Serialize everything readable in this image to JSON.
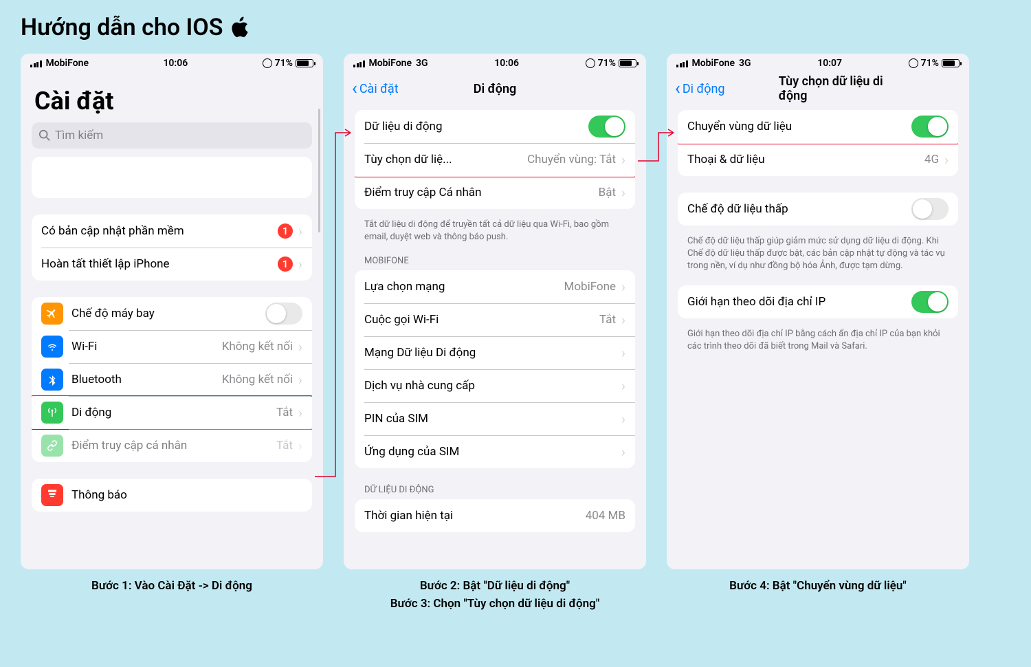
{
  "page": {
    "title": "Hướng dẫn cho IOS"
  },
  "phone1": {
    "status": {
      "carrier": "MobiFone",
      "net": "",
      "time": "10:06",
      "battery": "71%"
    },
    "title": "Cài đặt",
    "search_placeholder": "Tìm kiếm",
    "update_row": {
      "label": "Có bản cập nhật phần mềm",
      "badge": "1"
    },
    "finish_row": {
      "label": "Hoàn tất thiết lập iPhone",
      "badge": "1"
    },
    "rows": {
      "airplane": "Chế độ máy bay",
      "wifi": {
        "label": "Wi-Fi",
        "value": "Không kết nối"
      },
      "bluetooth": {
        "label": "Bluetooth",
        "value": "Không kết nối"
      },
      "mobile": {
        "label": "Di động",
        "value": "Tắt"
      },
      "hotspot": {
        "label": "Điểm truy cập cá nhân",
        "value": "Tắt"
      },
      "notifications": "Thông báo"
    }
  },
  "phone2": {
    "status": {
      "carrier": "MobiFone",
      "net": "3G",
      "time": "10:06",
      "battery": "71%"
    },
    "back": "Cài đặt",
    "title": "Di động",
    "rows": {
      "data": "Dữ liệu di động",
      "options": {
        "label": "Tùy chọn dữ liệ...",
        "value": "Chuyển vùng: Tắt"
      },
      "hotspot": {
        "label": "Điểm truy cập Cá nhân",
        "value": "Bật"
      }
    },
    "footer1": "Tắt dữ liệu di động để truyền tất cả dữ liệu qua Wi-Fi, bao gồm email, duyệt web và thông báo push.",
    "header_mobifone": "MOBIFONE",
    "rows2": {
      "network": {
        "label": "Lựa chọn mạng",
        "value": "MobiFone"
      },
      "wifi_call": {
        "label": "Cuộc gọi Wi-Fi",
        "value": "Tắt"
      },
      "data_net": "Mạng Dữ liệu Di động",
      "carrier_svc": "Dịch vụ nhà cung cấp",
      "sim_pin": "PIN của SIM",
      "sim_apps": "Ứng dụng của SIM"
    },
    "header_data": "DỮ LIỆU DI ĐỘNG",
    "rows3": {
      "current": {
        "label": "Thời gian hiện tại",
        "value": "404 MB"
      }
    }
  },
  "phone3": {
    "status": {
      "carrier": "MobiFone",
      "net": "3G",
      "time": "10:07",
      "battery": "71%"
    },
    "back": "Di động",
    "title": "Tùy chọn dữ liệu di động",
    "rows": {
      "roaming": "Chuyển vùng dữ liệu",
      "voice": {
        "label": "Thoại & dữ liệu",
        "value": "4G"
      }
    },
    "low_data": "Chế độ dữ liệu thấp",
    "low_data_footer": "Chế độ dữ liệu thấp giúp giảm mức sử dụng dữ liệu di động. Khi Chế độ dữ liệu thấp được bật, các bản cập nhật tự động và tác vụ trong nền, ví dụ như đồng bộ hóa Ảnh, được tạm dừng.",
    "ip_limit": "Giới hạn theo dõi địa chỉ IP",
    "ip_footer": "Giới hạn theo dõi địa chỉ IP bằng cách ẩn địa chỉ IP của bạn khỏi các trình theo dõi đã biết trong Mail và Safari."
  },
  "captions": {
    "c1": "Bước 1: Vào Cài Đặt -> Di động",
    "c2a": "Bước 2: Bật \"Dữ liệu di động\"",
    "c2b": "Bước 3: Chọn \"Tùy chọn dữ liệu di động\"",
    "c3": "Bước 4: Bật \"Chuyển vùng dữ liệu\""
  }
}
